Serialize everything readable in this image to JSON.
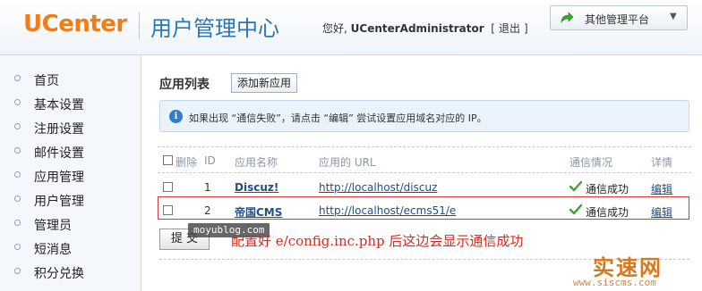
{
  "header": {
    "logo": "UCenter",
    "title": "用户管理中心",
    "greeting_prefix": "您好,",
    "username": "UCenterAdministrator",
    "logout_label": "退出",
    "platform_label": "其他管理平台"
  },
  "sidebar": {
    "items": [
      {
        "label": "首页"
      },
      {
        "label": "基本设置"
      },
      {
        "label": "注册设置"
      },
      {
        "label": "邮件设置"
      },
      {
        "label": "应用管理"
      },
      {
        "label": "用户管理"
      },
      {
        "label": "管理员"
      },
      {
        "label": "短消息"
      },
      {
        "label": "积分兑换"
      }
    ]
  },
  "main": {
    "section_title": "应用列表",
    "add_app_label": "添加新应用",
    "tip": "如果出现 “通信失败”，请点击 “编辑” 尝试设置应用域名对应的 IP。",
    "columns": {
      "delete": "删除",
      "id": "ID",
      "name": "应用名称",
      "url": "应用的 URL",
      "status": "通信情况",
      "detail": "详情"
    },
    "rows": [
      {
        "id": "1",
        "name": "Discuz!",
        "url": "http://localhost/discuz",
        "status": "通信成功",
        "edit": "编辑"
      },
      {
        "id": "2",
        "name": "帝国CMS",
        "url": "http://localhost/ecms51/e",
        "status": "通信成功",
        "edit": "编辑"
      }
    ],
    "submit_label": "提 交",
    "annotation": "配置好 e/config.inc.php 后这边会显示通信成功"
  },
  "watermarks": {
    "small": "moyublog.com",
    "site_big": "实速网",
    "site_url": "www.siscms.com"
  },
  "colors": {
    "logo": "#f07d16",
    "title": "#2d76b5",
    "link": "#1f4e8c",
    "success": "#3aa52b",
    "annotation": "#e0261c"
  }
}
